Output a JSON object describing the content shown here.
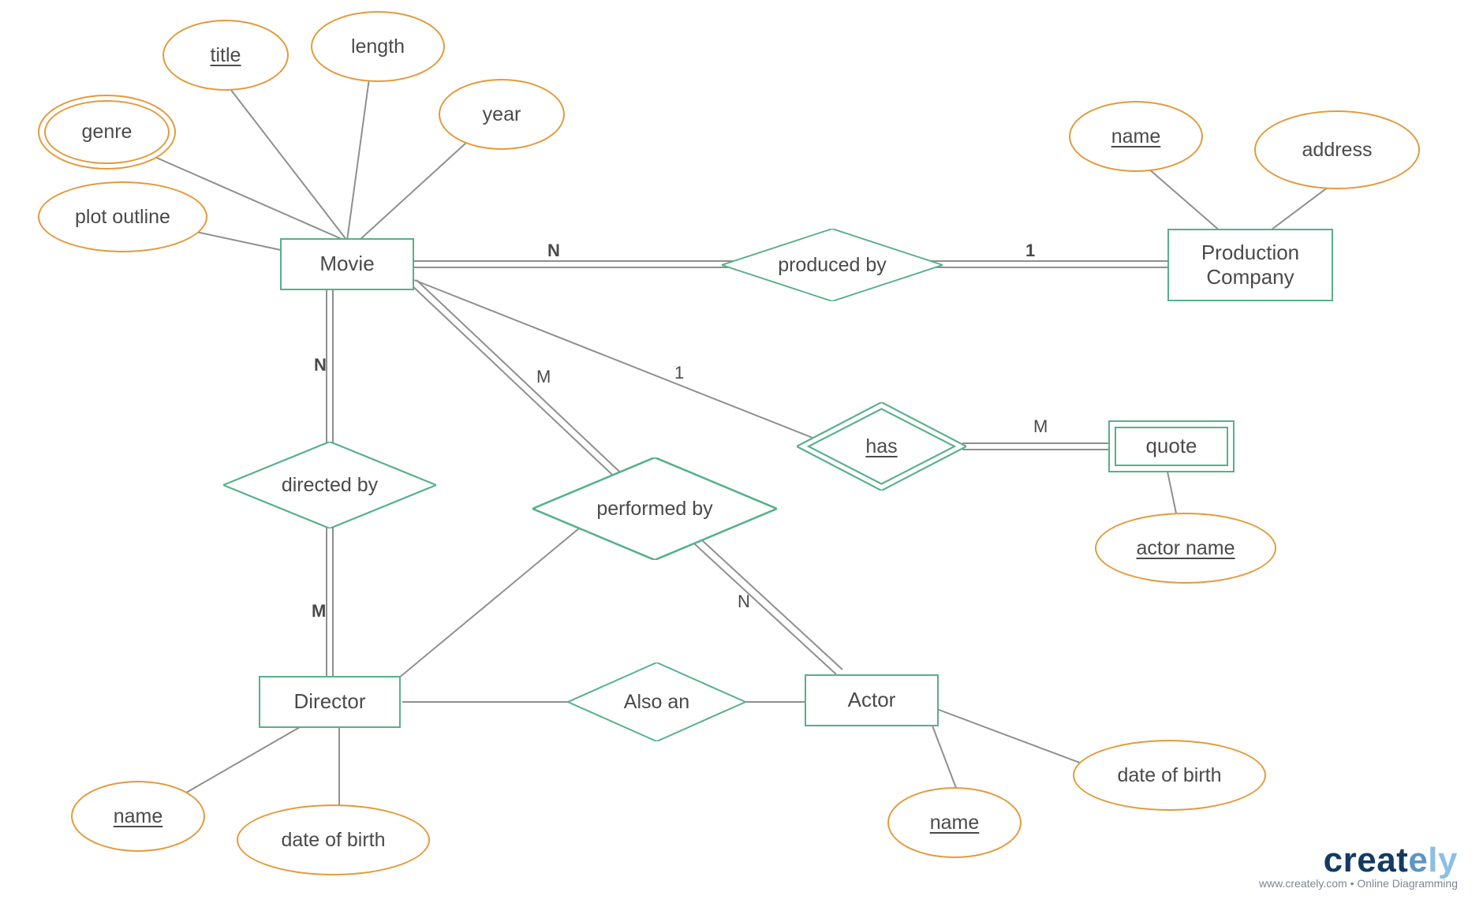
{
  "entities": {
    "movie": "Movie",
    "production_company": "Production\nCompany",
    "director": "Director",
    "actor": "Actor",
    "quote": "quote"
  },
  "relationships": {
    "produced_by": "produced by",
    "directed_by": "directed by",
    "performed_by": "performed by",
    "also_an": "Also an",
    "has": "has"
  },
  "attributes": {
    "movie": {
      "title": "title",
      "length": "length",
      "year": "year",
      "genre": "genre",
      "plot_outline": "plot outline"
    },
    "production_company": {
      "name": "name",
      "address": "address"
    },
    "director": {
      "name": "name",
      "dob": "date of birth"
    },
    "actor": {
      "name": "name",
      "dob": "date of birth"
    },
    "quote": {
      "actor_name": "actor name"
    }
  },
  "cardinalities": {
    "movie_produced": "N",
    "production_produced": "1",
    "movie_directed": "N",
    "director_directed": "M",
    "movie_performed": "M",
    "actor_performed": "N",
    "movie_has": "1",
    "quote_has": "M"
  },
  "watermark": {
    "brand_creat": "creat",
    "brand_e": "e",
    "brand_ly": "ly",
    "tagline": "www.creately.com • Online Diagramming"
  }
}
